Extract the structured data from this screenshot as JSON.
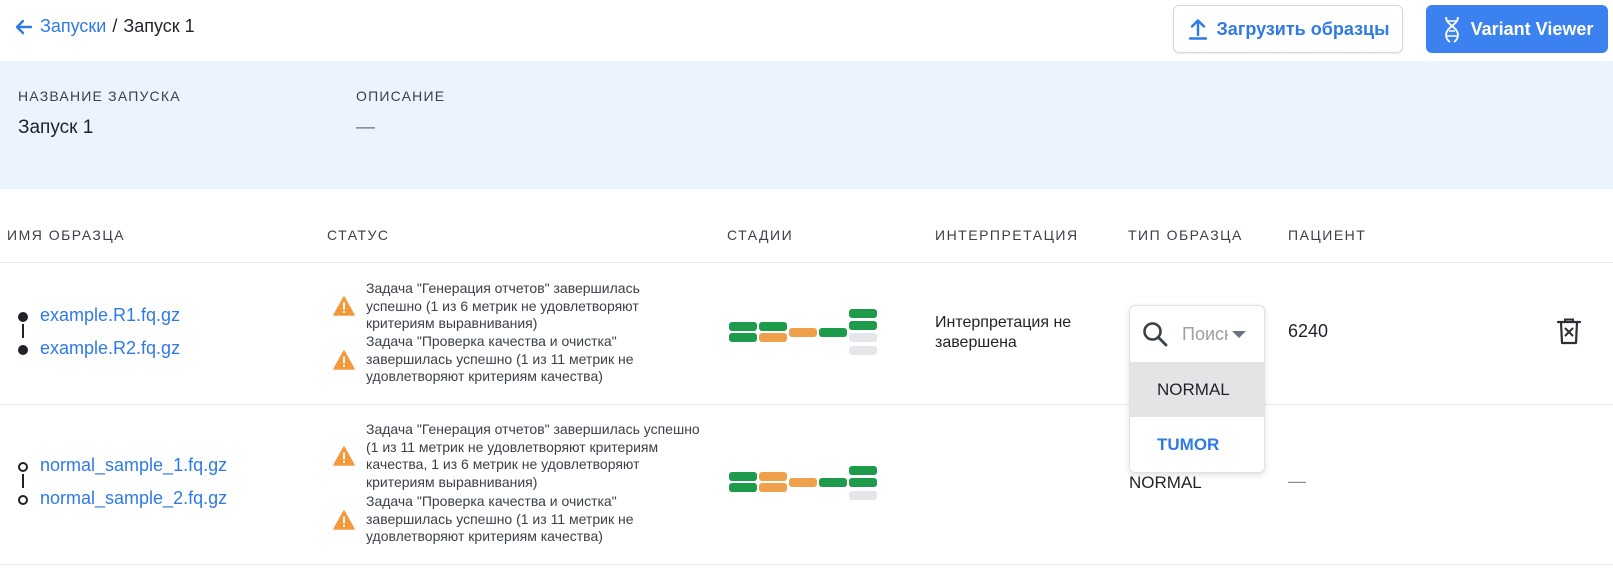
{
  "breadcrumb": {
    "parent": "Запуски",
    "separator": "/",
    "current": "Запуск 1"
  },
  "actions": {
    "upload_label": "Загрузить образцы",
    "viewer_label": "Variant Viewer"
  },
  "info": {
    "name_label": "НАЗВАНИЕ ЗАПУСКА",
    "name_value": "Запуск 1",
    "description_label": "ОПИСАНИЕ",
    "description_value": "—"
  },
  "table": {
    "headers": {
      "sample": "ИМЯ ОБРАЗЦА",
      "status": "СТАТУС",
      "stages": "СТАДИИ",
      "interpretation": "ИНТЕРПРЕТАЦИЯ",
      "sample_type": "ТИП ОБРАЗЦА",
      "patient": "ПАЦИЕНТ"
    },
    "rows": [
      {
        "files": [
          "example.R1.fq.gz",
          "example.R2.fq.gz"
        ],
        "statuses": [
          "Задача \"Генерация отчетов\" завершилась успешно (1 из 6 метрик не удовлетворяют критериям выравнивания)",
          "Задача \"Проверка качества и очистка\" завершилась успешно (1 из 11 метрик не удовлетворяют критериям качества)"
        ],
        "interpretation": "Интерпретация не завершена",
        "sample_type": "",
        "patient": "6240"
      },
      {
        "files": [
          "normal_sample_1.fq.gz",
          "normal_sample_2.fq.gz"
        ],
        "statuses": [
          "Задача \"Генерация отчетов\" завершилась успешно (1 из 11 метрик не удовлетворяют критериям качества, 1 из 6 метрик не удовлетворяют критериям выравнивания)",
          "Задача \"Проверка качества и очистка\" завершилась успешно (1 из 11 метрик не удовлетворяют критериям качества)"
        ],
        "interpretation": "",
        "sample_type": "NORMAL",
        "patient": "—"
      }
    ]
  },
  "dropdown": {
    "placeholder": "Поиск",
    "options": [
      "NORMAL",
      "TUMOR"
    ],
    "highlighted": "NORMAL"
  },
  "colors": {
    "link": "#2f7ae5",
    "stage_ok": "#1e9b4a",
    "stage_warn": "#f0a04b",
    "stage_pending": "#e4e6ea",
    "panel_bg": "#eaf3fe",
    "warning": "#f29a3a"
  },
  "icons": [
    "back-arrow-icon",
    "upload-icon",
    "dna-icon",
    "warning-icon",
    "delete-icon",
    "search-icon",
    "chevron-down-icon"
  ]
}
